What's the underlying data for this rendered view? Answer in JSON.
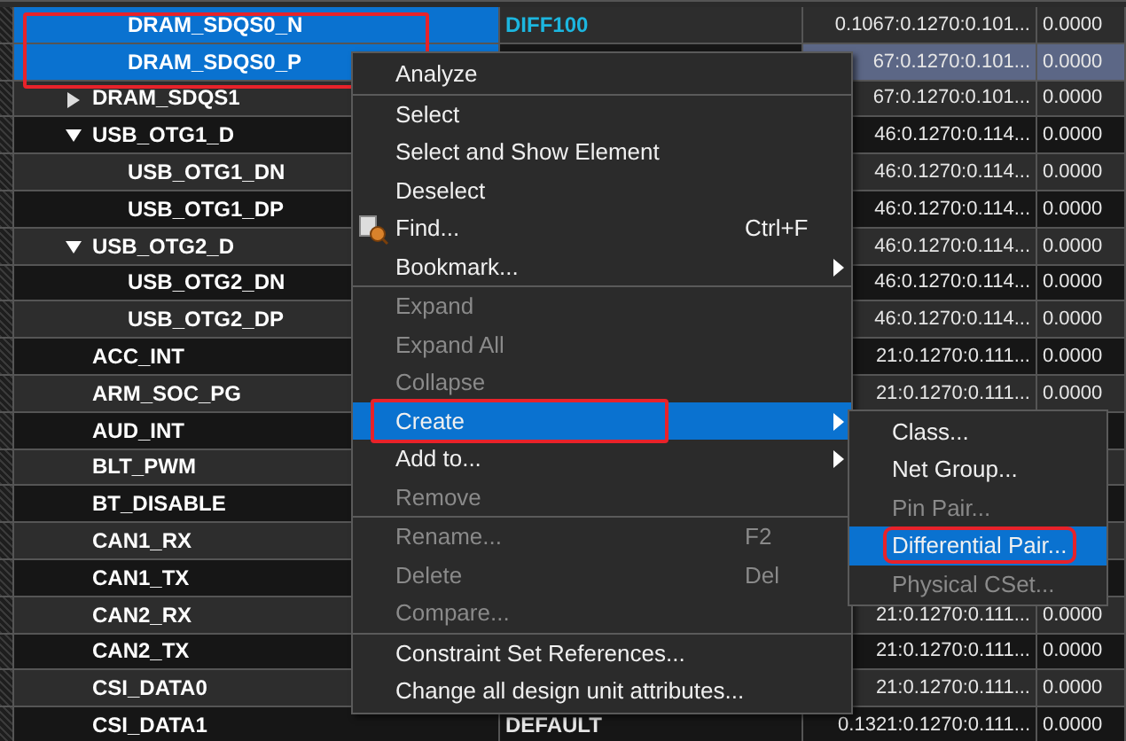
{
  "nets": [
    {
      "kind": "continued",
      "annotated": true,
      "children": [
        {
          "kind": "net",
          "name": "DRAM_SDQS0_N",
          "selected": true,
          "current": false,
          "column_2": "DIFF100",
          "column_3": "0.1067:0.1270:0.101...",
          "column_4": "0.0000"
        },
        {
          "kind": "net",
          "name": "DRAM_SDQS0_P",
          "selected": true,
          "current": true,
          "column_3": "67:0.1270:0.101...",
          "column_4": "0.0000"
        }
      ]
    },
    {
      "kind": "group",
      "name": "DRAM_SDQS1",
      "expanded": false,
      "selected": false,
      "current": false,
      "column_3": "67:0.1270:0.101...",
      "column_4": "0.0000"
    },
    {
      "kind": "group",
      "name": "USB_OTG1_D",
      "expanded": true,
      "selected": false,
      "current": false,
      "column_3": "46:0.1270:0.114...",
      "column_4": "0.0000",
      "children": [
        {
          "kind": "net",
          "name": "USB_OTG1_DN",
          "selected": false,
          "current": false,
          "column_3": "46:0.1270:0.114...",
          "column_4": "0.0000"
        },
        {
          "kind": "net",
          "name": "USB_OTG1_DP",
          "selected": false,
          "current": false,
          "column_3": "46:0.1270:0.114...",
          "column_4": "0.0000"
        }
      ]
    },
    {
      "kind": "group",
      "name": "USB_OTG2_D",
      "expanded": true,
      "selected": false,
      "current": false,
      "column_3": "46:0.1270:0.114...",
      "column_4": "0.0000",
      "children": [
        {
          "kind": "net",
          "name": "USB_OTG2_DN",
          "selected": false,
          "current": false,
          "column_3": "46:0.1270:0.114...",
          "column_4": "0.0000"
        },
        {
          "kind": "net",
          "name": "USB_OTG2_DP",
          "selected": false,
          "current": false,
          "column_3": "46:0.1270:0.114...",
          "column_4": "0.0000"
        }
      ]
    },
    {
      "kind": "net",
      "name": "ACC_INT",
      "selected": false,
      "current": false,
      "column_3": "21:0.1270:0.111...",
      "column_4": "0.0000"
    },
    {
      "kind": "net",
      "name": "ARM_SOC_PG",
      "selected": false,
      "current": false,
      "column_3": "21:0.1270:0.111...",
      "column_4": "0.0000"
    },
    {
      "kind": "net",
      "name": "AUD_INT",
      "selected": false
    },
    {
      "kind": "net",
      "name": "BLT_PWM",
      "selected": false
    },
    {
      "kind": "net",
      "name": "BT_DISABLE",
      "selected": false
    },
    {
      "kind": "net",
      "name": "CAN1_RX",
      "selected": false
    },
    {
      "kind": "net",
      "name": "CAN1_TX",
      "selected": false
    },
    {
      "kind": "net",
      "name": "CAN2_RX",
      "selected": false,
      "current": false,
      "column_3": "21:0.1270:0.111...",
      "column_4": "0.0000"
    },
    {
      "kind": "net",
      "name": "CAN2_TX",
      "selected": false,
      "current": false,
      "column_3": "21:0.1270:0.111...",
      "column_4": "0.0000"
    },
    {
      "kind": "net",
      "name": "CSI_DATA0",
      "selected": false,
      "current": false,
      "column_3": "21:0.1270:0.111...",
      "column_4": "0.0000"
    },
    {
      "kind": "net",
      "name": "CSI_DATA1",
      "selected": false,
      "current": false,
      "column_2": "DEFAULT",
      "column_3": "0.1321:0.1270:0.111...",
      "column_4": "0.0000"
    }
  ],
  "context_menu": {
    "items": [
      {
        "kind": "item",
        "label": "Analyze",
        "disabled": false,
        "selected": false,
        "annotated": false,
        "has_submenu": false
      },
      {
        "kind": "separator"
      },
      {
        "kind": "item",
        "label": "Select",
        "disabled": false,
        "selected": false,
        "annotated": false,
        "has_submenu": false
      },
      {
        "kind": "item",
        "label": "Select and Show Element",
        "disabled": false,
        "selected": false,
        "annotated": false,
        "has_submenu": false
      },
      {
        "kind": "item",
        "label": "Deselect",
        "disabled": false,
        "selected": false,
        "annotated": false,
        "has_submenu": false
      },
      {
        "kind": "item_with_icon",
        "label": "Find...",
        "shortcut": "Ctrl+F",
        "disabled": false,
        "selected": false,
        "annotated": false,
        "has_submenu": false
      },
      {
        "kind": "item",
        "label": "Bookmark...",
        "disabled": false,
        "selected": false,
        "annotated": false,
        "has_submenu": true
      },
      {
        "kind": "separator"
      },
      {
        "kind": "item",
        "label": "Expand",
        "disabled": true,
        "selected": false,
        "annotated": false,
        "has_submenu": false
      },
      {
        "kind": "item",
        "label": "Expand All",
        "disabled": true,
        "selected": false,
        "annotated": false,
        "has_submenu": false
      },
      {
        "kind": "item",
        "label": "Collapse",
        "disabled": true,
        "selected": false,
        "annotated": false,
        "has_submenu": false
      },
      {
        "kind": "item",
        "label": "Create",
        "disabled": false,
        "selected": true,
        "annotated": true,
        "has_submenu": true,
        "submenu": [
          {
            "label": "Class...",
            "disabled": false,
            "selected": false,
            "annotated": false
          },
          {
            "label": "Net Group...",
            "disabled": false,
            "selected": false,
            "annotated": false
          },
          {
            "label": "Pin Pair...",
            "disabled": true,
            "selected": false,
            "annotated": false
          },
          {
            "label": "Differential Pair...",
            "disabled": false,
            "selected": true,
            "annotated": true
          },
          {
            "label": "Physical CSet...",
            "disabled": true,
            "selected": false,
            "annotated": false
          }
        ]
      },
      {
        "kind": "item",
        "label": "Add to...",
        "disabled": false,
        "selected": false,
        "annotated": false,
        "has_submenu": true
      },
      {
        "kind": "item",
        "label": "Remove",
        "disabled": true,
        "selected": false,
        "annotated": false,
        "has_submenu": false
      },
      {
        "kind": "separator"
      },
      {
        "kind": "item",
        "label": "Rename...",
        "shortcut": "F2",
        "disabled": true,
        "selected": false,
        "annotated": false,
        "has_submenu": false
      },
      {
        "kind": "item",
        "label": "Delete",
        "shortcut": "Del",
        "disabled": true,
        "selected": false,
        "annotated": false,
        "has_submenu": false
      },
      {
        "kind": "item",
        "label": "Compare...",
        "disabled": true,
        "selected": false,
        "annotated": false,
        "has_submenu": false
      },
      {
        "kind": "separator"
      },
      {
        "kind": "item",
        "label": "Constraint Set References...",
        "disabled": false,
        "selected": false,
        "annotated": false,
        "has_submenu": false
      },
      {
        "kind": "item",
        "label": "Change all design unit attributes...",
        "disabled": false,
        "selected": false,
        "annotated": false,
        "has_submenu": false
      }
    ]
  }
}
